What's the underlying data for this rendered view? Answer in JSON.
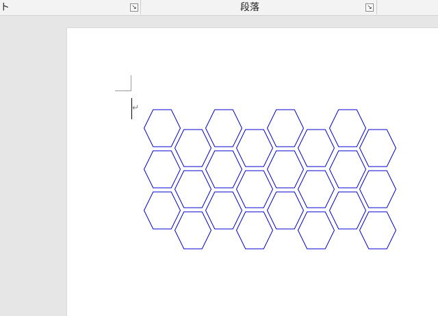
{
  "ribbon": {
    "left_group_label": "ト",
    "paragraph_group_label": "段落",
    "launcher_icon": "dialog-launcher-icon"
  },
  "document": {
    "paragraph_mark": "↵",
    "shape_color": "#0000cc",
    "hexagon_count": 24
  }
}
